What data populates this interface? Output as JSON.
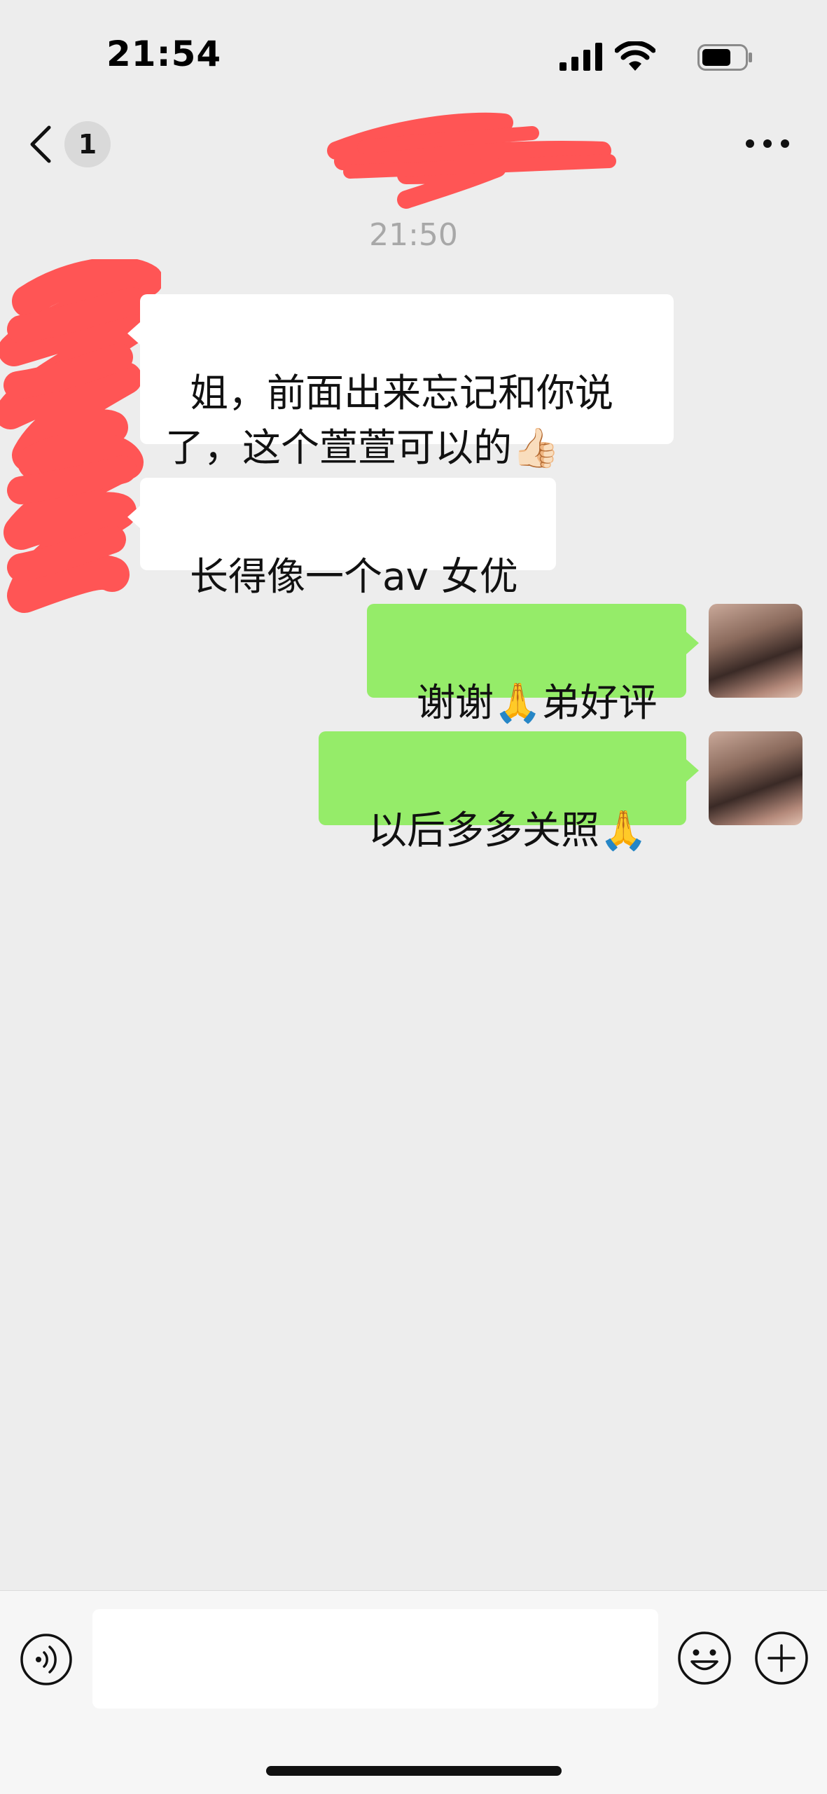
{
  "status_bar": {
    "time": "21:54",
    "icons": [
      "cellular-signal-icon",
      "wifi-icon",
      "battery-icon"
    ]
  },
  "nav": {
    "back_icon": "chevron-left-icon",
    "unread_count": "1",
    "title_redacted": true,
    "more_icon": "more-dots-icon"
  },
  "chat": {
    "timestamp": "21:50",
    "messages": [
      {
        "direction": "incoming",
        "text": "姐，前面出来忘记和你说了，这个萱萱可以的👍🏻"
      },
      {
        "direction": "incoming",
        "text": "长得像一个av 女优"
      },
      {
        "direction": "outgoing",
        "text": "谢谢🙏弟好评"
      },
      {
        "direction": "outgoing",
        "text": "以后多多关照🙏"
      }
    ]
  },
  "input_bar": {
    "voice_icon": "voice-input-icon",
    "input_value": "",
    "emoji_icon": "emoji-icon",
    "plus_icon": "plus-circle-icon"
  },
  "colors": {
    "background": "#ededed",
    "incoming_bubble": "#ffffff",
    "outgoing_bubble": "#95ec69",
    "redaction": "#ff5555",
    "timestamp": "#a8a8a8"
  }
}
